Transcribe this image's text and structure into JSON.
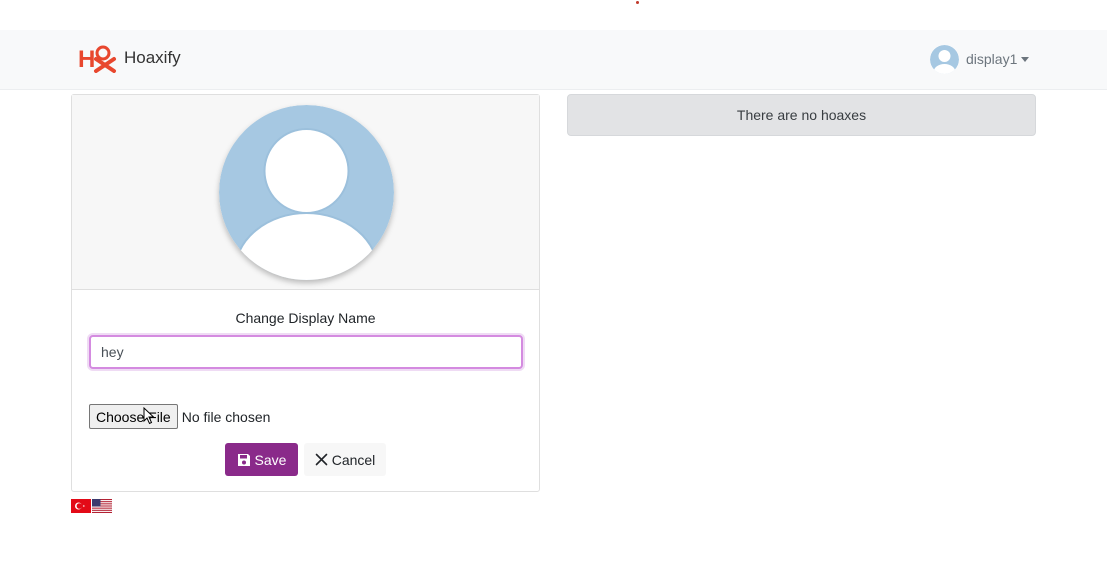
{
  "app": {
    "brand_name": "Hoaxify"
  },
  "navbar": {
    "username": "display1"
  },
  "profile_card": {
    "change_display_name_label": "Change Display Name",
    "display_name_value": "hey",
    "file_input": {
      "button_label": "Choose File",
      "status_text": "No file chosen"
    },
    "save_label": "Save",
    "cancel_label": "Cancel"
  },
  "hoax_feed": {
    "empty_message": "There are no hoaxes"
  },
  "languages": [
    {
      "code": "tr",
      "flag": "turkey-flag-icon"
    },
    {
      "code": "en",
      "flag": "usa-flag-icon"
    }
  ],
  "colors": {
    "primary": "#8a2a8a",
    "navbar_bg": "#f8f9fa",
    "alert_bg": "#e2e3e5",
    "avatar_bg": "#a6c8e2",
    "focus_border": "#d48be0"
  }
}
